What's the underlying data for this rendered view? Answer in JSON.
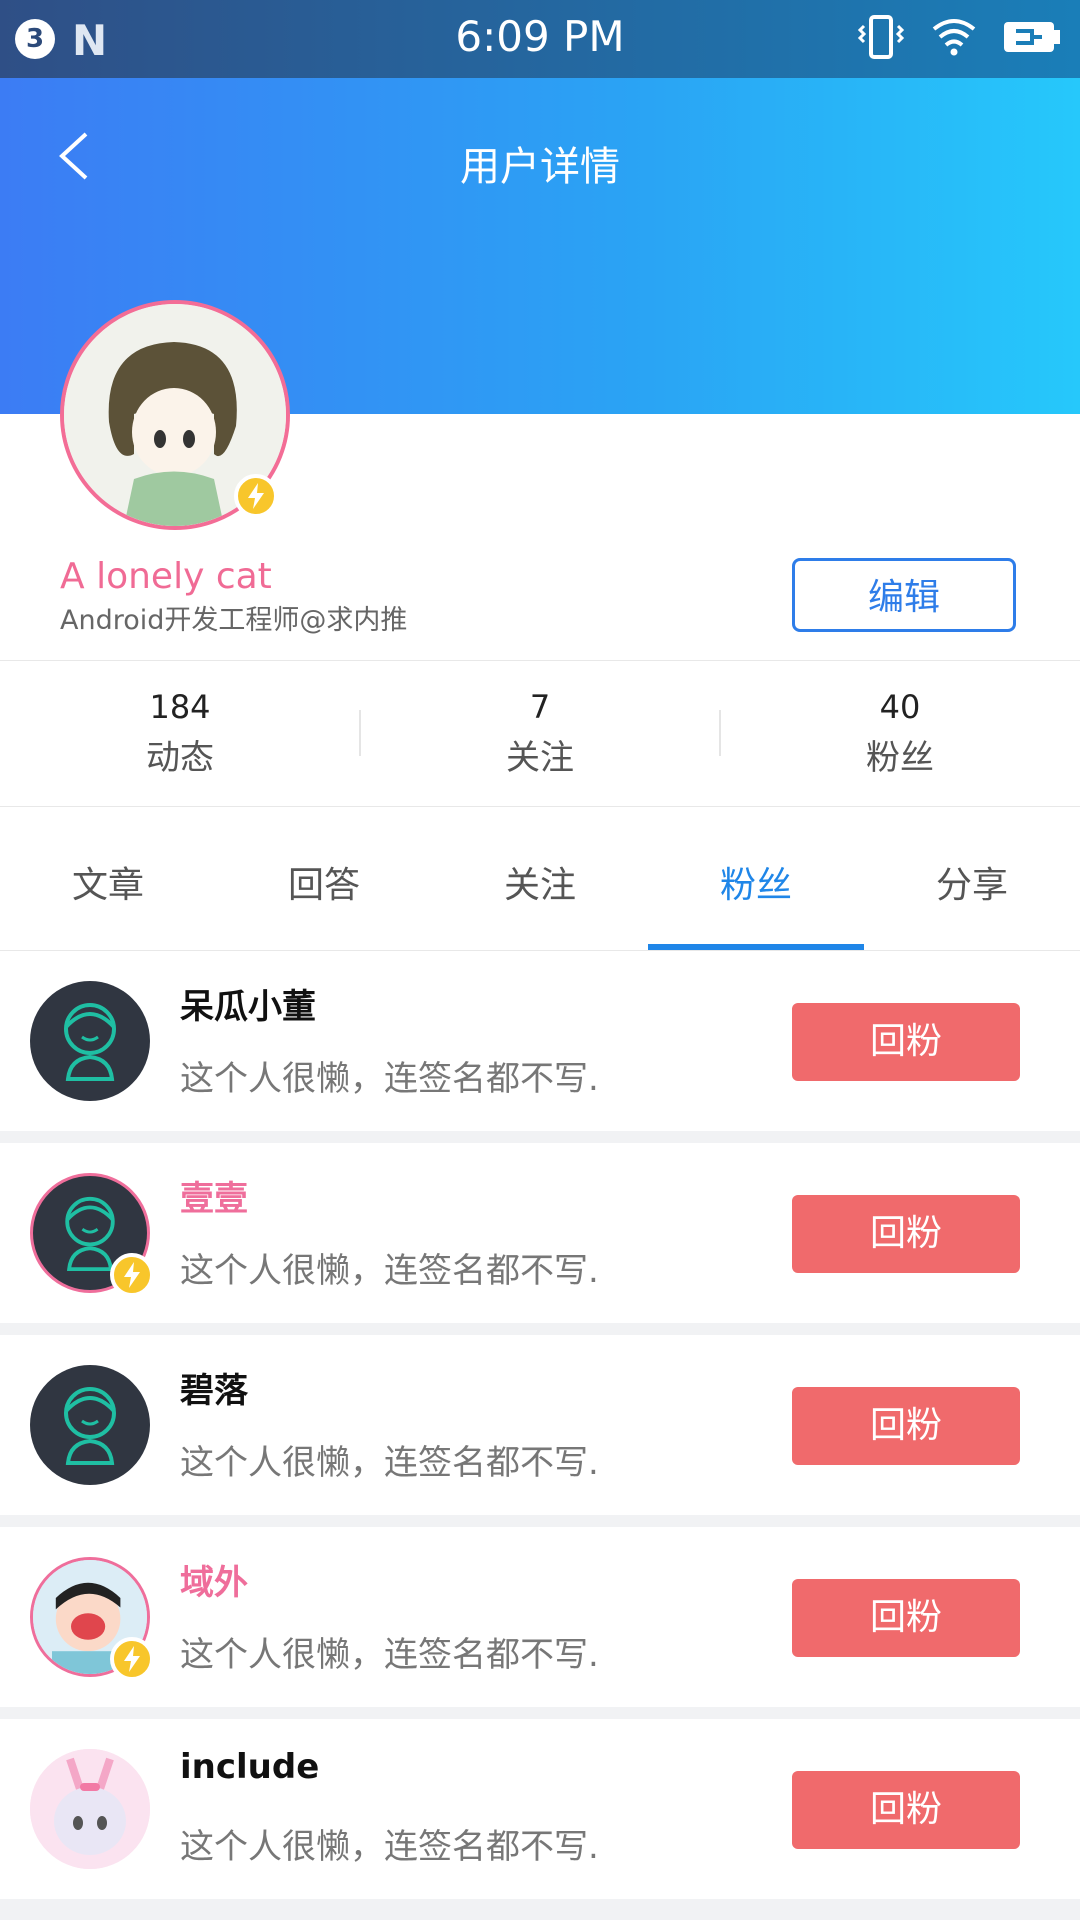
{
  "status_bar": {
    "badge": "3",
    "n_icon": "N",
    "time": "6:09 PM"
  },
  "header": {
    "title": "用户详情",
    "back_icon": "chevron-left-icon"
  },
  "profile": {
    "name": "A lonely cat",
    "signature": "Android开发工程师@求内推",
    "edit_label": "编辑"
  },
  "stats": [
    {
      "value": "184",
      "label": "动态"
    },
    {
      "value": "7",
      "label": "关注"
    },
    {
      "value": "40",
      "label": "粉丝"
    }
  ],
  "tabs": [
    {
      "label": "文章"
    },
    {
      "label": "回答"
    },
    {
      "label": "关注"
    },
    {
      "label": "粉丝",
      "active": true
    },
    {
      "label": "分享"
    }
  ],
  "followers": [
    {
      "name": "呆瓜小董",
      "signature": "这个人很懒，连签名都不写.",
      "button": "回粉",
      "vip": false
    },
    {
      "name": "壹壹",
      "signature": "这个人很懒，连签名都不写.",
      "button": "回粉",
      "vip": true
    },
    {
      "name": "碧落",
      "signature": "这个人很懒，连签名都不写.",
      "button": "回粉",
      "vip": false
    },
    {
      "name": "域外",
      "signature": "这个人很懒，连签名都不写.",
      "button": "回粉",
      "vip": true
    },
    {
      "name": "include",
      "signature": "这个人很懒，连签名都不写.",
      "button": "回粉",
      "vip": false
    }
  ],
  "colors": {
    "accent": "#1f86e8",
    "pink": "#ef6e9b",
    "follow_button": "#f06a6c",
    "vip_badge": "#f8c62b"
  }
}
